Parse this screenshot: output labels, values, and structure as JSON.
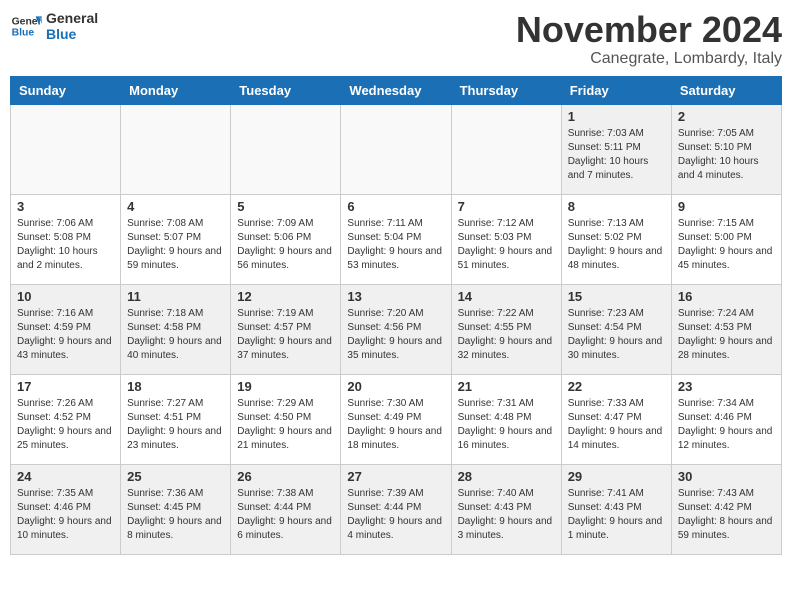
{
  "header": {
    "logo_general": "General",
    "logo_blue": "Blue",
    "month_title": "November 2024",
    "location": "Canegrate, Lombardy, Italy"
  },
  "weekdays": [
    "Sunday",
    "Monday",
    "Tuesday",
    "Wednesday",
    "Thursday",
    "Friday",
    "Saturday"
  ],
  "weeks": [
    [
      {
        "day": "",
        "info": ""
      },
      {
        "day": "",
        "info": ""
      },
      {
        "day": "",
        "info": ""
      },
      {
        "day": "",
        "info": ""
      },
      {
        "day": "",
        "info": ""
      },
      {
        "day": "1",
        "info": "Sunrise: 7:03 AM\nSunset: 5:11 PM\nDaylight: 10 hours and 7 minutes."
      },
      {
        "day": "2",
        "info": "Sunrise: 7:05 AM\nSunset: 5:10 PM\nDaylight: 10 hours and 4 minutes."
      }
    ],
    [
      {
        "day": "3",
        "info": "Sunrise: 7:06 AM\nSunset: 5:08 PM\nDaylight: 10 hours and 2 minutes."
      },
      {
        "day": "4",
        "info": "Sunrise: 7:08 AM\nSunset: 5:07 PM\nDaylight: 9 hours and 59 minutes."
      },
      {
        "day": "5",
        "info": "Sunrise: 7:09 AM\nSunset: 5:06 PM\nDaylight: 9 hours and 56 minutes."
      },
      {
        "day": "6",
        "info": "Sunrise: 7:11 AM\nSunset: 5:04 PM\nDaylight: 9 hours and 53 minutes."
      },
      {
        "day": "7",
        "info": "Sunrise: 7:12 AM\nSunset: 5:03 PM\nDaylight: 9 hours and 51 minutes."
      },
      {
        "day": "8",
        "info": "Sunrise: 7:13 AM\nSunset: 5:02 PM\nDaylight: 9 hours and 48 minutes."
      },
      {
        "day": "9",
        "info": "Sunrise: 7:15 AM\nSunset: 5:00 PM\nDaylight: 9 hours and 45 minutes."
      }
    ],
    [
      {
        "day": "10",
        "info": "Sunrise: 7:16 AM\nSunset: 4:59 PM\nDaylight: 9 hours and 43 minutes."
      },
      {
        "day": "11",
        "info": "Sunrise: 7:18 AM\nSunset: 4:58 PM\nDaylight: 9 hours and 40 minutes."
      },
      {
        "day": "12",
        "info": "Sunrise: 7:19 AM\nSunset: 4:57 PM\nDaylight: 9 hours and 37 minutes."
      },
      {
        "day": "13",
        "info": "Sunrise: 7:20 AM\nSunset: 4:56 PM\nDaylight: 9 hours and 35 minutes."
      },
      {
        "day": "14",
        "info": "Sunrise: 7:22 AM\nSunset: 4:55 PM\nDaylight: 9 hours and 32 minutes."
      },
      {
        "day": "15",
        "info": "Sunrise: 7:23 AM\nSunset: 4:54 PM\nDaylight: 9 hours and 30 minutes."
      },
      {
        "day": "16",
        "info": "Sunrise: 7:24 AM\nSunset: 4:53 PM\nDaylight: 9 hours and 28 minutes."
      }
    ],
    [
      {
        "day": "17",
        "info": "Sunrise: 7:26 AM\nSunset: 4:52 PM\nDaylight: 9 hours and 25 minutes."
      },
      {
        "day": "18",
        "info": "Sunrise: 7:27 AM\nSunset: 4:51 PM\nDaylight: 9 hours and 23 minutes."
      },
      {
        "day": "19",
        "info": "Sunrise: 7:29 AM\nSunset: 4:50 PM\nDaylight: 9 hours and 21 minutes."
      },
      {
        "day": "20",
        "info": "Sunrise: 7:30 AM\nSunset: 4:49 PM\nDaylight: 9 hours and 18 minutes."
      },
      {
        "day": "21",
        "info": "Sunrise: 7:31 AM\nSunset: 4:48 PM\nDaylight: 9 hours and 16 minutes."
      },
      {
        "day": "22",
        "info": "Sunrise: 7:33 AM\nSunset: 4:47 PM\nDaylight: 9 hours and 14 minutes."
      },
      {
        "day": "23",
        "info": "Sunrise: 7:34 AM\nSunset: 4:46 PM\nDaylight: 9 hours and 12 minutes."
      }
    ],
    [
      {
        "day": "24",
        "info": "Sunrise: 7:35 AM\nSunset: 4:46 PM\nDaylight: 9 hours and 10 minutes."
      },
      {
        "day": "25",
        "info": "Sunrise: 7:36 AM\nSunset: 4:45 PM\nDaylight: 9 hours and 8 minutes."
      },
      {
        "day": "26",
        "info": "Sunrise: 7:38 AM\nSunset: 4:44 PM\nDaylight: 9 hours and 6 minutes."
      },
      {
        "day": "27",
        "info": "Sunrise: 7:39 AM\nSunset: 4:44 PM\nDaylight: 9 hours and 4 minutes."
      },
      {
        "day": "28",
        "info": "Sunrise: 7:40 AM\nSunset: 4:43 PM\nDaylight: 9 hours and 3 minutes."
      },
      {
        "day": "29",
        "info": "Sunrise: 7:41 AM\nSunset: 4:43 PM\nDaylight: 9 hours and 1 minute."
      },
      {
        "day": "30",
        "info": "Sunrise: 7:43 AM\nSunset: 4:42 PM\nDaylight: 8 hours and 59 minutes."
      }
    ]
  ]
}
